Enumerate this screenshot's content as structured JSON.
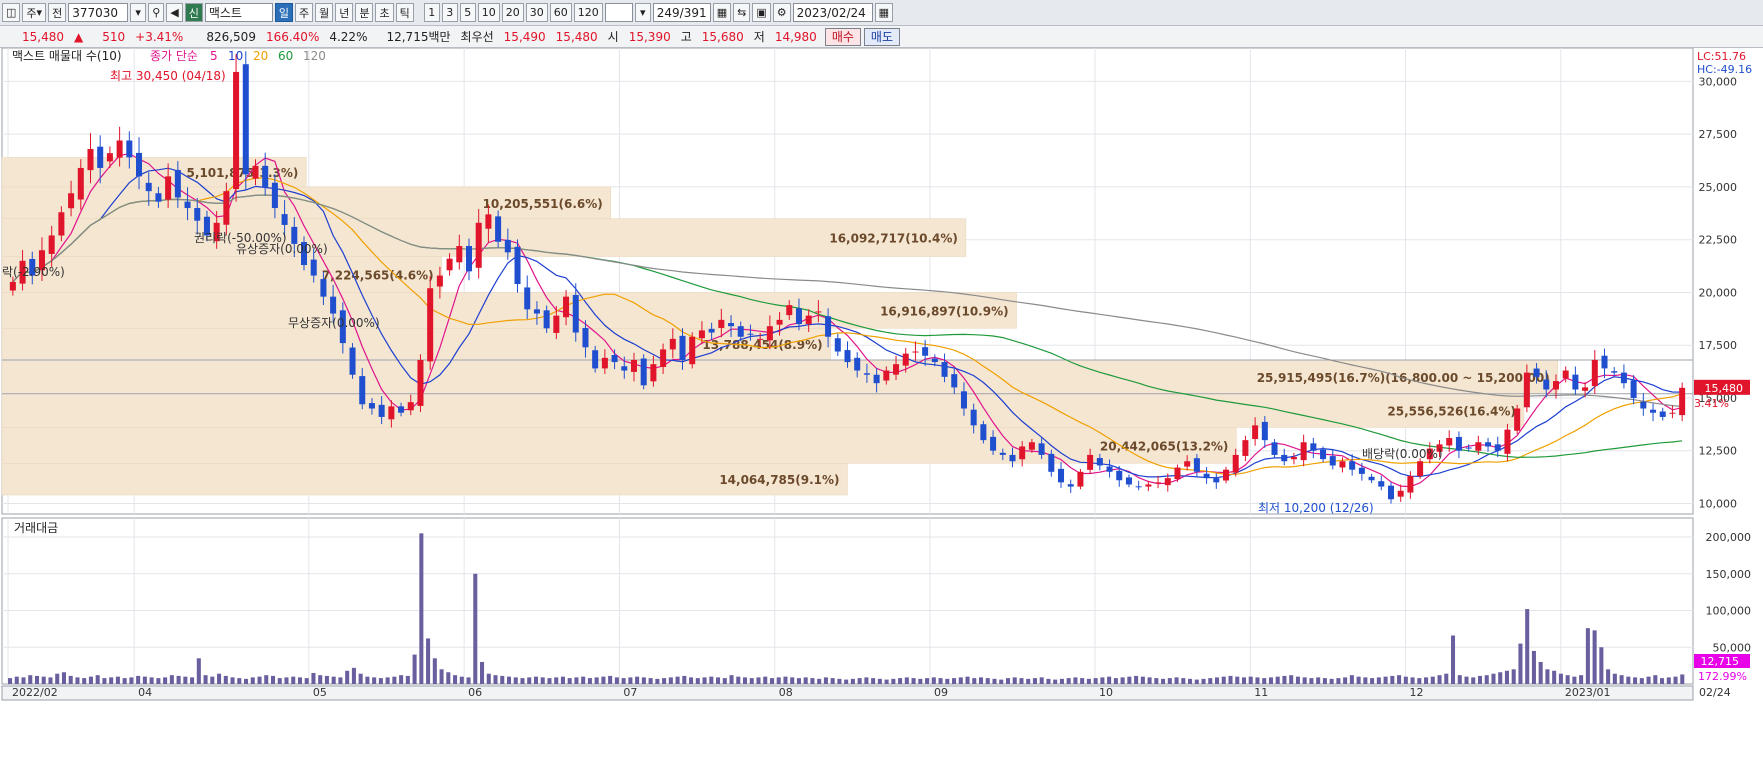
{
  "toolbar": {
    "period_label": "주",
    "market_label": "전",
    "code": "377030",
    "name_tag": "신",
    "name": "맥스트",
    "tabs": [
      "일",
      "주",
      "월",
      "년",
      "분",
      "초",
      "틱"
    ],
    "intervals": [
      "1",
      "3",
      "5",
      "10",
      "20",
      "30",
      "60",
      "120"
    ],
    "count": "249/391",
    "date": "2023/02/24"
  },
  "quote": {
    "price": "15,480",
    "change": "510",
    "change_pct": "+3.41%",
    "volume": "826,509",
    "volume_ratio": "166.40%",
    "turnover": "4.22%",
    "amount": "12,715백만",
    "best_label": "최우선",
    "ask": "15,490",
    "bid": "15,480",
    "open_label": "시",
    "open": "15,390",
    "high_label": "고",
    "high": "15,680",
    "low_label": "저",
    "low": "14,980",
    "buy_label": "매수",
    "sell_label": "매도"
  },
  "colors": {
    "up": "#e0142a",
    "down": "#1f4fcf",
    "ma5": "#e0148c",
    "ma10": "#1d3fd0",
    "ma20": "#f0a000",
    "ma60": "#1f9a3a",
    "ma120": "#8a8a8a",
    "band": "#f5e6d2",
    "volume": "#6a5f9e"
  },
  "legend": {
    "indicator": "맥스트 매물대 수(10)",
    "ma_title": "종가 단순",
    "periods": [
      "5",
      "10",
      "20",
      "60",
      "120"
    ]
  },
  "volume_title": "거래대금",
  "chart_data": {
    "type": "candlestick",
    "price_axis": {
      "min": 10000,
      "max": 30000,
      "ticks": [
        "30,000",
        "27,500",
        "25,000",
        "22,500",
        "20,000",
        "17,500",
        "15,000",
        "12,500",
        "10,000"
      ]
    },
    "volume_axis": {
      "ticks": [
        "200,000",
        "150,000",
        "100,000",
        "50,000"
      ]
    },
    "x_labels": [
      "2022/02",
      "04",
      "05",
      "06",
      "07",
      "08",
      "09",
      "10",
      "11",
      "12",
      "2023/01",
      "02",
      "02/24"
    ],
    "lc_label": "LC:51.76",
    "hc_label": "HC:-49.16",
    "current_price": "15,480",
    "current_pct": "3.41%",
    "current_volume": "12,715",
    "current_volume_pct": "172.99%",
    "annotations": {
      "high": "최고 30,450 (04/18)",
      "low": "최저 10,200 (12/26)",
      "events": [
        "권리락(-50.00%)",
        "유상증자(0.00%)",
        "무상증자(0.00%)",
        "배당락(0.00%)",
        "락(-2.90%)"
      ]
    },
    "volume_profile": [
      {
        "label": "5,101,875(3.3%)",
        "lo": 25000,
        "hi": 26400
      },
      {
        "label": "10,205,551(6.6%)",
        "lo": 23500,
        "hi": 25000
      },
      {
        "label": "16,092,717(10.4%)",
        "lo": 21700,
        "hi": 23500
      },
      {
        "label": "7,224,565(4.6%)",
        "lo": 20000,
        "hi": 21700
      },
      {
        "label": "16,916,897(10.9%)",
        "lo": 18300,
        "hi": 20000
      },
      {
        "label": "13,788,454(8.9%)",
        "lo": 16800,
        "hi": 18300
      },
      {
        "label": "25,915,495(16.7%)(16,800.00 ~ 15,200.00)",
        "lo": 15200,
        "hi": 16800
      },
      {
        "label": "25,556,526(16.4%)",
        "lo": 13600,
        "hi": 15200
      },
      {
        "label": "20,442,065(13.2%)",
        "lo": 11900,
        "hi": 13600
      },
      {
        "label": "14,064,785(9.1%)",
        "lo": 10400,
        "hi": 11900
      }
    ],
    "series": [
      {
        "month": "2022/02",
        "close": [
          20500,
          21500,
          20800,
          22000,
          22700,
          23800,
          24700,
          25900,
          26800,
          25900,
          26600,
          27200,
          26400
        ]
      },
      {
        "month": "04",
        "close": [
          25500,
          24800,
          24300,
          25500,
          24500,
          24000,
          23400,
          22700,
          23300,
          24800,
          30450,
          25600,
          26000,
          25000,
          24000,
          23200,
          22300,
          21300
        ]
      },
      {
        "month": "05",
        "close": [
          20800,
          19800,
          19000,
          17600,
          16100,
          14700,
          14500,
          14100,
          14600,
          14300,
          14800,
          16800,
          20200,
          20800,
          21600,
          22200
        ]
      },
      {
        "month": "06",
        "close": [
          21000,
          23300,
          23700,
          22400,
          21900,
          20400,
          19200,
          19000,
          18300,
          18900,
          19800,
          18100,
          17400,
          16400,
          16900,
          16700
        ]
      },
      {
        "month": "07",
        "close": [
          16300,
          16800,
          15600,
          16600,
          17300,
          17800,
          16800,
          17900,
          18200,
          18100,
          18700,
          18400,
          17900,
          18000,
          17800,
          18400
        ]
      },
      {
        "month": "08",
        "close": [
          18700,
          19400,
          18500,
          18900,
          19100,
          17900,
          17200,
          16700,
          16300,
          16100,
          15700,
          16300,
          16600,
          17100,
          17200,
          17000
        ]
      },
      {
        "month": "09",
        "close": [
          16700,
          16000,
          15500,
          14500,
          13700,
          13000,
          12500,
          12300,
          12000,
          12700,
          12900,
          12300,
          11500,
          11000,
          10800,
          11500,
          12300
        ]
      },
      {
        "month": "10",
        "close": [
          11800,
          11500,
          11100,
          10900,
          10800,
          10900,
          11000,
          11200,
          11700,
          12000,
          11500,
          11200,
          11000,
          11600,
          12300,
          13000
        ]
      },
      {
        "month": "11",
        "close": [
          13700,
          13000,
          12300,
          12000,
          12200,
          12900,
          12500,
          12100,
          11800,
          12000,
          11600,
          11400,
          11100,
          10800,
          10200,
          10600
        ]
      },
      {
        "month": "12",
        "close": [
          11300,
          12000,
          12600,
          12800,
          13100,
          12500,
          12600,
          12900,
          12700,
          12500,
          13500,
          14500,
          16200,
          16000,
          15400,
          15800
        ]
      },
      {
        "month": "2023/01",
        "close": [
          16300,
          15400,
          15500,
          16800,
          16400,
          16200,
          15700,
          15000,
          14500,
          14300,
          14100,
          14300,
          15480
        ]
      }
    ],
    "volume_series": [
      8,
      10,
      9,
      12,
      11,
      10,
      9,
      14,
      16,
      11,
      9,
      8,
      10,
      12,
      8,
      9,
      10,
      8,
      9,
      11,
      10,
      9,
      8,
      9,
      12,
      11,
      10,
      9,
      35,
      12,
      10,
      14,
      11,
      9,
      8,
      7,
      9,
      10,
      12,
      11,
      8,
      9,
      10,
      9,
      8,
      15,
      12,
      11,
      10,
      9,
      18,
      22,
      14,
      10,
      9,
      8,
      9,
      10,
      12,
      11,
      40,
      205,
      62,
      35,
      20,
      16,
      12,
      10,
      9,
      150,
      30,
      14,
      12,
      11,
      10,
      9,
      8,
      9,
      10,
      9,
      8,
      9,
      10,
      8,
      9,
      10,
      8,
      9,
      10,
      11,
      9,
      8,
      9,
      10,
      9,
      8,
      7,
      8,
      9,
      10,
      11,
      9,
      8,
      9,
      10,
      9,
      8,
      12,
      10,
      9,
      8,
      9,
      10,
      8,
      9,
      10,
      9,
      8,
      9,
      8,
      7,
      9,
      8,
      7,
      6,
      7,
      8,
      9,
      8,
      7,
      6,
      7,
      8,
      9,
      8,
      7,
      8,
      9,
      8,
      7,
      8,
      9,
      10,
      8,
      9,
      8,
      7,
      6,
      8,
      9,
      8,
      7,
      8,
      9,
      7,
      6,
      7,
      8,
      9,
      8,
      7,
      8,
      9,
      10,
      8,
      9,
      10,
      11,
      10,
      9,
      8,
      7,
      8,
      9,
      8,
      7,
      6,
      7,
      8,
      9,
      10,
      11,
      10,
      9,
      10,
      9,
      8,
      9,
      10,
      11,
      12,
      10,
      9,
      8,
      9,
      8,
      7,
      8,
      9,
      12,
      10,
      9,
      8,
      9,
      10,
      11,
      12,
      10,
      9,
      8,
      9,
      10,
      12,
      14,
      66,
      12,
      10,
      9,
      11,
      12,
      14,
      16,
      18,
      20,
      55,
      102,
      45,
      30,
      20,
      18,
      14,
      12,
      10,
      12,
      76,
      73,
      50,
      20,
      14,
      12,
      10,
      9,
      8,
      10,
      12,
      8,
      9,
      10,
      13
    ]
  }
}
